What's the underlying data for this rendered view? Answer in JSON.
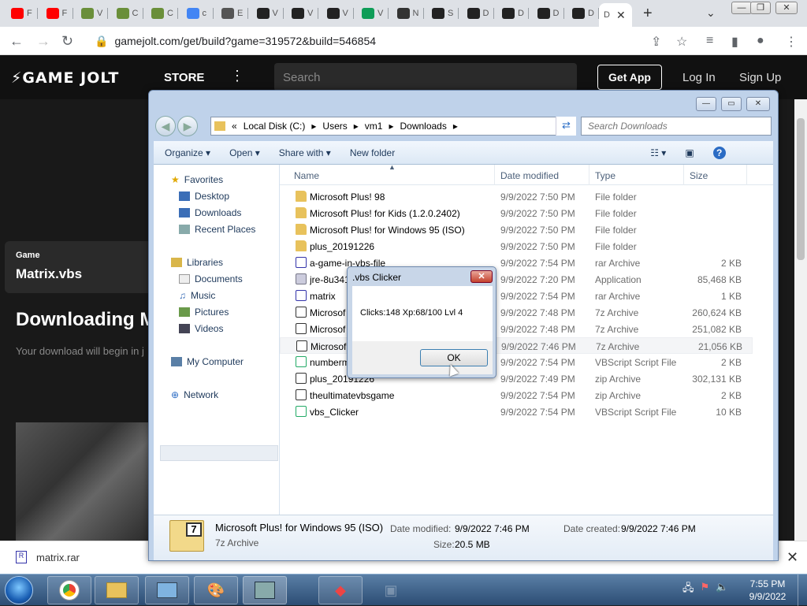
{
  "browser": {
    "tabs": [
      {
        "icon": "youtube-icon",
        "label": "F",
        "color": "#ff0000"
      },
      {
        "icon": "youtube-icon",
        "label": "F",
        "color": "#ff0000"
      },
      {
        "icon": "minecraft-icon",
        "label": "V",
        "color": "#6a8f3a"
      },
      {
        "icon": "minecraft-icon",
        "label": "C",
        "color": "#6a8f3a"
      },
      {
        "icon": "minecraft-icon",
        "label": "C",
        "color": "#6a8f3a"
      },
      {
        "icon": "google-icon",
        "label": "c",
        "color": "#4285f4"
      },
      {
        "icon": "globe-icon",
        "label": "E",
        "color": "#555555"
      },
      {
        "icon": "wiki-w-icon",
        "label": "V",
        "color": "#222222"
      },
      {
        "icon": "wiki-w-icon",
        "label": "V",
        "color": "#222222"
      },
      {
        "icon": "wiki-w-icon",
        "label": "V",
        "color": "#222222"
      },
      {
        "icon": "sheet-icon",
        "label": "V",
        "color": "#0f9d58"
      },
      {
        "icon": "archive-icon",
        "label": "N",
        "color": "#333333"
      },
      {
        "icon": "gamejolt-icon",
        "label": "S",
        "color": "#222222"
      },
      {
        "icon": "gamejolt-icon",
        "label": "D",
        "color": "#222222"
      },
      {
        "icon": "gamejolt-icon",
        "label": "D",
        "color": "#222222"
      },
      {
        "icon": "gamejolt-icon",
        "label": "D",
        "color": "#222222"
      },
      {
        "icon": "gamejolt-icon",
        "label": "D",
        "color": "#222222"
      }
    ],
    "active_tab": {
      "label": "D",
      "close": "✕"
    },
    "new_tab": "+",
    "url": "gamejolt.com/get/build?game=319572&build=546854"
  },
  "gamejolt": {
    "logo": "⚡GAME JOLT",
    "store": "STORE",
    "search_placeholder": "Search",
    "get_app": "Get App",
    "login": "Log In",
    "signup": "Sign Up",
    "game_label": "Game",
    "game_name": "Matrix.vbs",
    "downloading": "Downloading M",
    "download_sub": "Your download will begin in j"
  },
  "download_bar": {
    "file": "matrix.rar",
    "close": "✕"
  },
  "explorer": {
    "breadcrumb": [
      "«",
      "Local Disk (C:)",
      "Users",
      "vm1",
      "Downloads"
    ],
    "search_placeholder": "Search Downloads",
    "commands": [
      "Organize ▾",
      "Open ▾",
      "Share with ▾",
      "New folder"
    ],
    "nav": {
      "favorites": "Favorites",
      "desktop": "Desktop",
      "downloads": "Downloads",
      "recent": "Recent Places",
      "libraries": "Libraries",
      "documents": "Documents",
      "music": "Music",
      "pictures": "Pictures",
      "videos": "Videos",
      "computer": "My Computer",
      "network": "Network"
    },
    "columns": {
      "name": "Name",
      "date": "Date modified",
      "type": "Type",
      "size": "Size"
    },
    "files": [
      {
        "name": "Microsoft Plus! 98",
        "date": "9/9/2022 7:50 PM",
        "type": "File folder",
        "size": "",
        "kind": "folder"
      },
      {
        "name": "Microsoft Plus! for Kids (1.2.0.2402)",
        "date": "9/9/2022 7:50 PM",
        "type": "File folder",
        "size": "",
        "kind": "folder"
      },
      {
        "name": "Microsoft Plus! for Windows 95 (ISO)",
        "date": "9/9/2022 7:50 PM",
        "type": "File folder",
        "size": "",
        "kind": "folder"
      },
      {
        "name": "plus_20191226",
        "date": "9/9/2022 7:50 PM",
        "type": "File folder",
        "size": "",
        "kind": "folder"
      },
      {
        "name": "a-game-in-vbs-file",
        "date": "9/9/2022 7:54 PM",
        "type": "rar Archive",
        "size": "2 KB",
        "kind": "rar"
      },
      {
        "name": "jre-8u341",
        "date": "9/9/2022 7:20 PM",
        "type": "Application",
        "size": "85,468 KB",
        "kind": "app"
      },
      {
        "name": "matrix",
        "date": "9/9/2022 7:54 PM",
        "type": "rar Archive",
        "size": "1 KB",
        "kind": "rar"
      },
      {
        "name": "Microsof",
        "date": "9/9/2022 7:48 PM",
        "type": "7z Archive",
        "size": "260,624 KB",
        "kind": "sz"
      },
      {
        "name": "Microsof",
        "date": "9/9/2022 7:48 PM",
        "type": "7z Archive",
        "size": "251,082 KB",
        "kind": "sz"
      },
      {
        "name": "Microsof",
        "date": "9/9/2022 7:46 PM",
        "type": "7z Archive",
        "size": "21,056 KB",
        "kind": "sz"
      },
      {
        "name": "numberm",
        "date": "9/9/2022 7:54 PM",
        "type": "VBScript Script File",
        "size": "2 KB",
        "kind": "vbs"
      },
      {
        "name": "plus_20191226",
        "date": "9/9/2022 7:49 PM",
        "type": "zip Archive",
        "size": "302,131 KB",
        "kind": "sz"
      },
      {
        "name": "theultimatevbsgame",
        "date": "9/9/2022 7:54 PM",
        "type": "zip Archive",
        "size": "2 KB",
        "kind": "sz"
      },
      {
        "name": "vbs_Clicker",
        "date": "9/9/2022 7:54 PM",
        "type": "VBScript Script File",
        "size": "10 KB",
        "kind": "vbs"
      }
    ],
    "details": {
      "name": "Microsoft Plus! for Windows 95 (ISO)",
      "type": "7z Archive",
      "modified_label": "Date modified:",
      "modified": "9/9/2022 7:46 PM",
      "created_label": "Date created:",
      "created": "9/9/2022 7:46 PM",
      "size_label": "Size:",
      "size": "20.5 MB",
      "icon_glyph": "7"
    }
  },
  "dialog": {
    "title": ".vbs Clicker",
    "message": "Clicks:148 Xp:68/100 Lvl 4",
    "ok": "OK",
    "close": "✕"
  },
  "taskbar": {
    "time": "7:55 PM",
    "date": "9/9/2022"
  }
}
